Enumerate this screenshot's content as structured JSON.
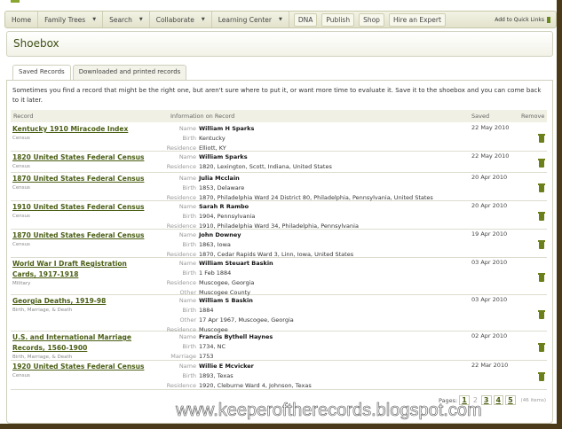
{
  "nav": {
    "items": [
      {
        "label": "Home",
        "caret": false
      },
      {
        "label": "Family Trees",
        "caret": true
      },
      {
        "label": "Search",
        "caret": true
      },
      {
        "label": "Collaborate",
        "caret": true
      },
      {
        "label": "Learning Center",
        "caret": true
      }
    ],
    "pills": [
      "DNA",
      "Publish",
      "Shop",
      "Hire an Expert"
    ],
    "quick_links": "Add to Quick Links"
  },
  "page_title": "Shoebox",
  "tabs": [
    "Saved Records",
    "Downloaded and printed records"
  ],
  "intro": "Sometimes you find a record that might be the right one, but aren't sure where to put it, or want more time to evaluate it. Save it to the shoebox and you can come back to it later.",
  "columns": {
    "record": "Record",
    "info": "Information on Record",
    "saved": "Saved",
    "remove": "Remove"
  },
  "rows": [
    {
      "title": "Kentucky 1910 Miracode Index",
      "category": "Census",
      "fields": [
        [
          "Name",
          "William H Sparks"
        ],
        [
          "Birth",
          "Kentucky"
        ],
        [
          "Residence",
          "Elliott, KY"
        ]
      ],
      "saved": "22 May 2010"
    },
    {
      "title": "1820 United States Federal Census",
      "category": "Census",
      "fields": [
        [
          "Name",
          "William Sparks"
        ],
        [
          "Residence",
          "1820, Lexington, Scott, Indiana, United States"
        ]
      ],
      "saved": "22 May 2010"
    },
    {
      "title": "1870 United States Federal Census",
      "category": "Census",
      "fields": [
        [
          "Name",
          "Julia Mcclain"
        ],
        [
          "Birth",
          "1853, Delaware"
        ],
        [
          "Residence",
          "1870, Philadelphia Ward 24 District 80, Philadelphia, Pennsylvania, United States"
        ]
      ],
      "saved": "20 Apr 2010"
    },
    {
      "title": "1910 United States Federal Census",
      "category": "Census",
      "fields": [
        [
          "Name",
          "Sarah R Rambo"
        ],
        [
          "Birth",
          "1904, Pennsylvania"
        ],
        [
          "Residence",
          "1910, Philadelphia Ward 34, Philadelphia, Pennsylvania"
        ]
      ],
      "saved": "20 Apr 2010"
    },
    {
      "title": "1870 United States Federal Census",
      "category": "Census",
      "fields": [
        [
          "Name",
          "John Downey"
        ],
        [
          "Birth",
          "1863, Iowa"
        ],
        [
          "Residence",
          "1870, Cedar Rapids Ward 3, Linn, Iowa, United States"
        ]
      ],
      "saved": "19 Apr 2010"
    },
    {
      "title": "World War I Draft Registration Cards, 1917-1918",
      "category": "Military",
      "fields": [
        [
          "Name",
          "William Steuart Baskin"
        ],
        [
          "Birth",
          "1 Feb 1884"
        ],
        [
          "Residence",
          "Muscogee, Georgia"
        ],
        [
          "Other",
          "Muscogee County"
        ]
      ],
      "saved": "03 Apr 2010"
    },
    {
      "title": "Georgia Deaths, 1919-98",
      "category": "Birth, Marriage, & Death",
      "fields": [
        [
          "Name",
          "William S Baskin"
        ],
        [
          "Birth",
          "1884"
        ],
        [
          "Other",
          "17 Apr 1967, Muscogee, Georgia"
        ],
        [
          "Residence",
          "Muscogee"
        ]
      ],
      "saved": "03 Apr 2010"
    },
    {
      "title": "U.S. and International Marriage Records, 1560-1900",
      "category": "Birth, Marriage, & Death",
      "fields": [
        [
          "Name",
          "Francis Bythell Haynes"
        ],
        [
          "Birth",
          "1734, NC"
        ],
        [
          "Marriage",
          "1753"
        ]
      ],
      "saved": "02 Apr 2010"
    },
    {
      "title": "1920 United States Federal Census",
      "category": "Census",
      "fields": [
        [
          "Name",
          "Willie E Mcvicker"
        ],
        [
          "Birth",
          "1893, Texas"
        ],
        [
          "Residence",
          "1920, Cleburne Ward 4, Johnson, Texas"
        ]
      ],
      "saved": "22 Mar 2010"
    }
  ],
  "pagination": {
    "label": "Pages:",
    "pages": [
      "1",
      "2",
      "3",
      "4",
      "5"
    ],
    "current": "2",
    "count": "(46 items)"
  },
  "watermark": "www.keeperoftherecords.blogspot.com"
}
